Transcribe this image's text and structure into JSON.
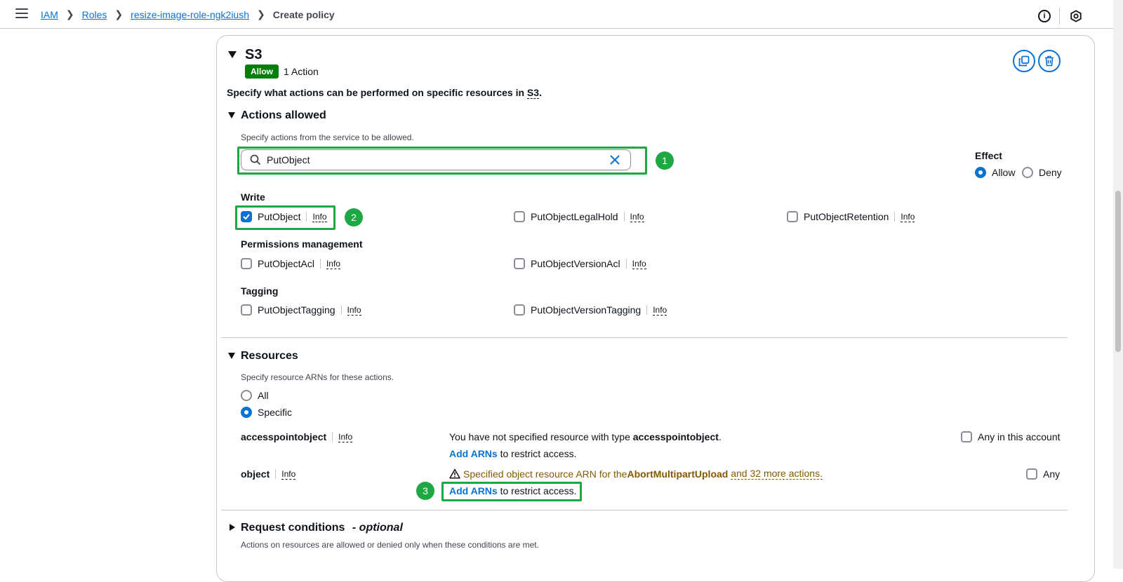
{
  "breadcrumb": {
    "item1": "IAM",
    "item2": "Roles",
    "item3": "resize-image-role-ngk2iush",
    "current": "Create policy"
  },
  "service": {
    "title": "S3",
    "effect_badge": "Allow",
    "action_count": "1 Action",
    "description_prefix": "Specify what actions can be performed on specific resources in ",
    "description_service": "S3",
    "description_suffix": "."
  },
  "actions": {
    "title": "Actions allowed",
    "hint": "Specify actions from the service to be allowed.",
    "search_value": "PutObject",
    "effect_label": "Effect",
    "effect_allow": "Allow",
    "effect_deny": "Deny",
    "selected_effect": "Allow",
    "groups": {
      "write": {
        "label": "Write",
        "items": [
          {
            "name": "PutObject",
            "checked": true
          },
          {
            "name": "PutObjectLegalHold",
            "checked": false
          },
          {
            "name": "PutObjectRetention",
            "checked": false
          }
        ]
      },
      "permissions": {
        "label": "Permissions management",
        "items": [
          {
            "name": "PutObjectAcl",
            "checked": false
          },
          {
            "name": "PutObjectVersionAcl",
            "checked": false
          }
        ]
      },
      "tagging": {
        "label": "Tagging",
        "items": [
          {
            "name": "PutObjectTagging",
            "checked": false
          },
          {
            "name": "PutObjectVersionTagging",
            "checked": false
          }
        ]
      }
    },
    "info_label": "Info"
  },
  "resources": {
    "title": "Resources",
    "hint": "Specify resource ARNs for these actions.",
    "option_all": "All",
    "option_specific": "Specific",
    "selected": "Specific",
    "accesspoint": {
      "label": "accesspointobject",
      "msg_prefix": "You have not specified resource with type ",
      "msg_type": "accesspointobject",
      "msg_suffix": ".",
      "add_arns": "Add ARNs",
      "restrict": " to restrict access.",
      "any_label": "Any in this account"
    },
    "object": {
      "label": "object",
      "warn_prefix": "Specified object resource ARN for the ",
      "warn_action": "AbortMultipartUpload",
      "warn_more": "and 32 more actions.",
      "add_arns": "Add ARNs",
      "restrict": " to restrict access.",
      "any_label": "Any"
    }
  },
  "conditions": {
    "title": "Request conditions",
    "optional": "- optional",
    "hint": "Actions on resources are allowed or denied only when these conditions are met."
  },
  "annotations": [
    "1",
    "2",
    "3"
  ],
  "colors": {
    "accent": "#0972d3",
    "success": "#037f0c",
    "highlight": "#1ea843",
    "warning": "#855900"
  }
}
